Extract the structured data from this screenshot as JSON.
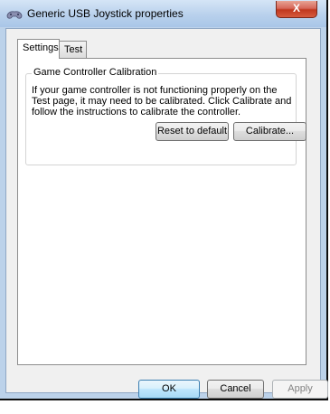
{
  "window": {
    "title": "Generic  USB Joystick  properties",
    "close_glyph": "X"
  },
  "tabs": [
    {
      "label": "Settings",
      "selected": true
    },
    {
      "label": "Test",
      "selected": false
    }
  ],
  "calibration": {
    "group_label": "Game Controller Calibration",
    "description": "If your game controller is not functioning properly on the Test page, it may need to be calibrated.  Click Calibrate and follow the instructions to calibrate the controller.",
    "reset_label": "Reset to default",
    "calibrate_label": "Calibrate..."
  },
  "footer": {
    "ok_label": "OK",
    "cancel_label": "Cancel",
    "apply_label": "Apply"
  },
  "colors": {
    "titlebar": "#b9d1ec",
    "close_button": "#c0381f",
    "default_button_border": "#3c7fb1"
  },
  "icons": [
    "joystick-icon",
    "close-icon"
  ]
}
